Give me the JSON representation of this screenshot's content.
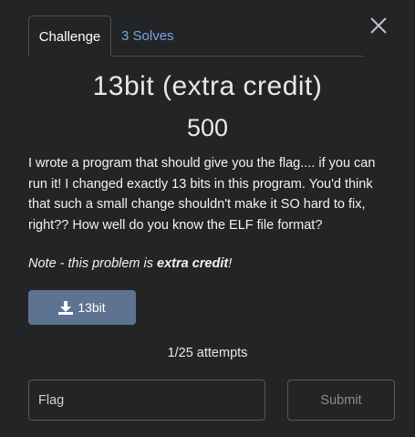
{
  "tabs": {
    "challenge": "Challenge",
    "solves": "3 Solves"
  },
  "close_icon": "close-icon",
  "challenge": {
    "title": "13bit (extra credit)",
    "points": "500",
    "description": "I wrote a program that should give you the flag.... if you can run it! I changed exactly 13 bits in this program. You'd think that such a small change shouldn't make it SO hard to fix, right?? How well do you know the ELF file format?",
    "note_prefix": "Note - this problem is ",
    "note_bold": "extra credit",
    "note_suffix": "!"
  },
  "download": {
    "icon": "download-icon",
    "label": "13bit"
  },
  "attempts": "1/25 attempts",
  "form": {
    "flag_placeholder": "Flag",
    "submit_label": "Submit"
  },
  "colors": {
    "background": "#222426",
    "accent_link": "#7aa7e0",
    "download_button": "#5e7391"
  }
}
